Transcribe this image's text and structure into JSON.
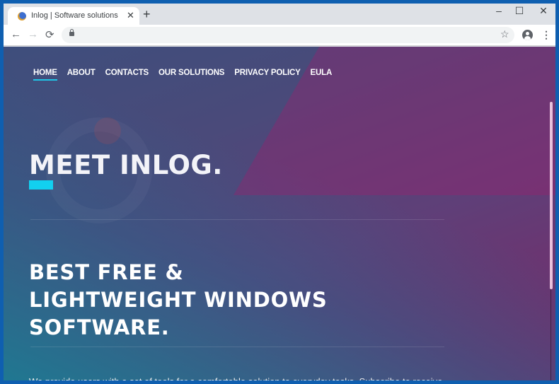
{
  "browser": {
    "tab": {
      "title": "Inlog | Software solutions",
      "favicon": "globe-icon"
    },
    "new_tab_label": "+",
    "window_controls": {
      "minimize": "–",
      "maximize": "☐",
      "close": "✕"
    },
    "toolbar": {
      "back": "←",
      "forward": "→",
      "reload": "⟳",
      "star": "☆",
      "menu": "⋮"
    },
    "address": ""
  },
  "page": {
    "nav": [
      {
        "label": "HOME",
        "active": true
      },
      {
        "label": "ABOUT"
      },
      {
        "label": "CONTACTS"
      },
      {
        "label": "OUR SOLUTIONS"
      },
      {
        "label": "PRIVACY POLICY"
      },
      {
        "label": "EULA"
      }
    ],
    "hero_title": "MEET INLOG.",
    "subtitle_lines": [
      "BEST FREE &",
      "LIGHTWEIGHT WINDOWS",
      "SOFTWARE."
    ],
    "description": "We provide users with a set of tools for a comfortable solution to everyday tasks. Subscribe to receive",
    "colors": {
      "accent": "#12d0f0",
      "nav_underline": "#1fc6e6"
    }
  }
}
